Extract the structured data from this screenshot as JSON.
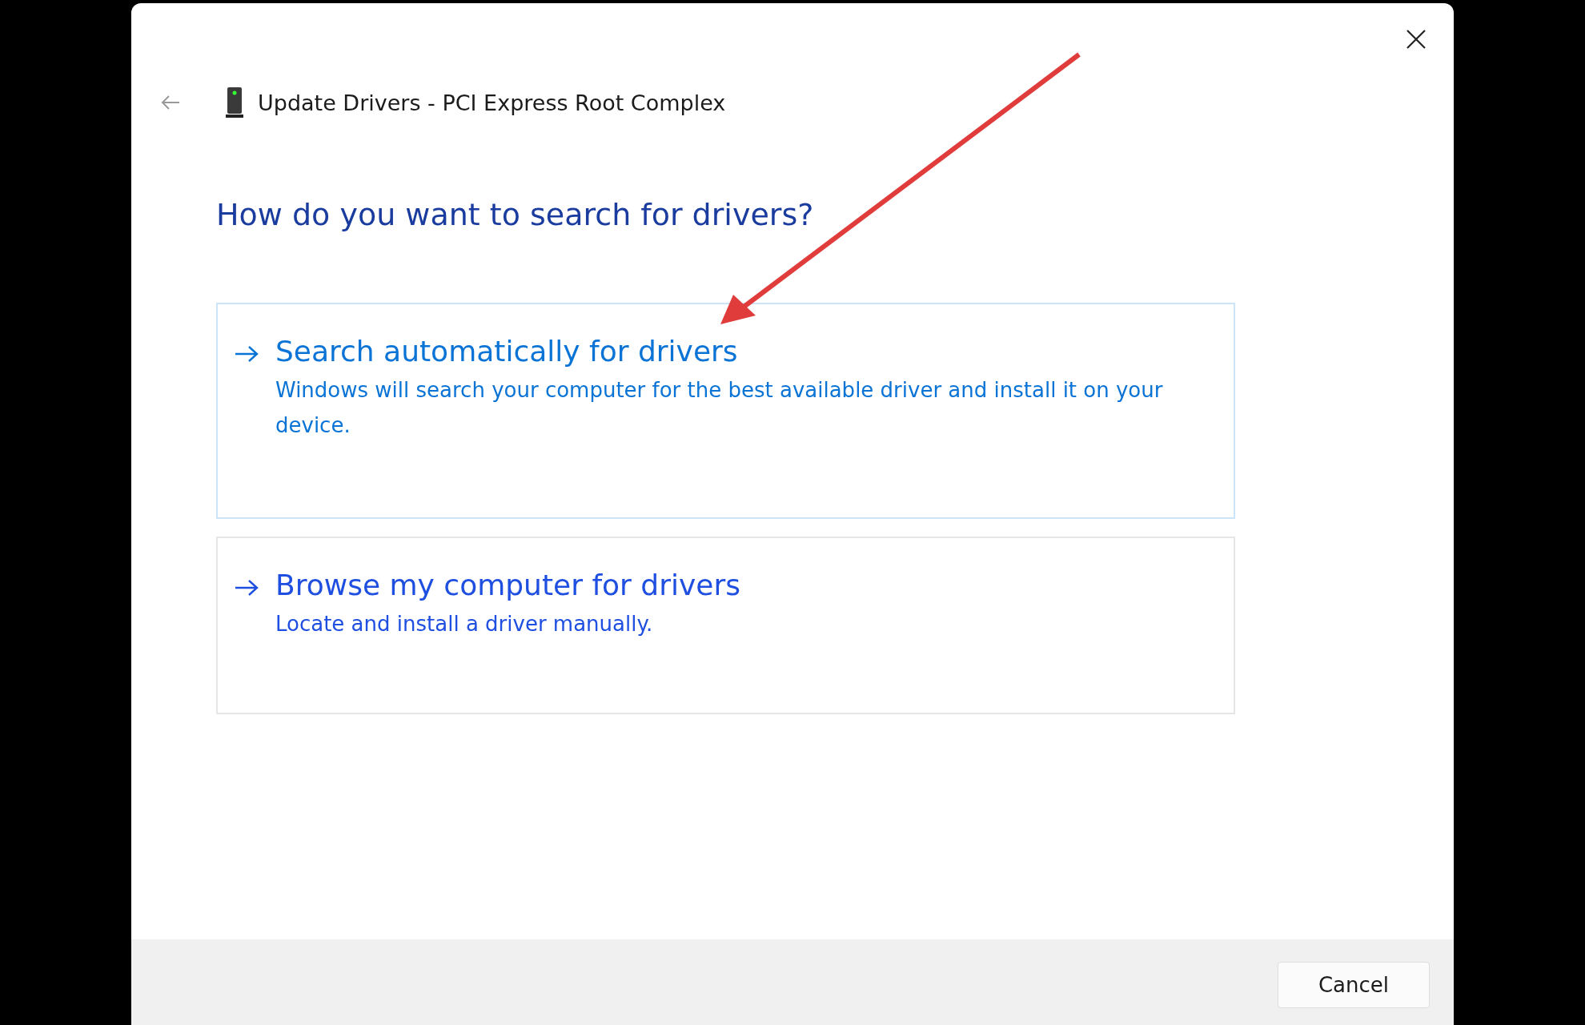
{
  "window": {
    "title": "Update Drivers - PCI Express Root Complex"
  },
  "heading": "How do you want to search for drivers?",
  "options": [
    {
      "title": "Search automatically for drivers",
      "description": "Windows will search your computer for the best available driver and install it on your device.",
      "selected": true
    },
    {
      "title": "Browse my computer for drivers",
      "description": "Locate and install a driver manually.",
      "selected": false
    }
  ],
  "buttons": [
    "Cancel"
  ]
}
